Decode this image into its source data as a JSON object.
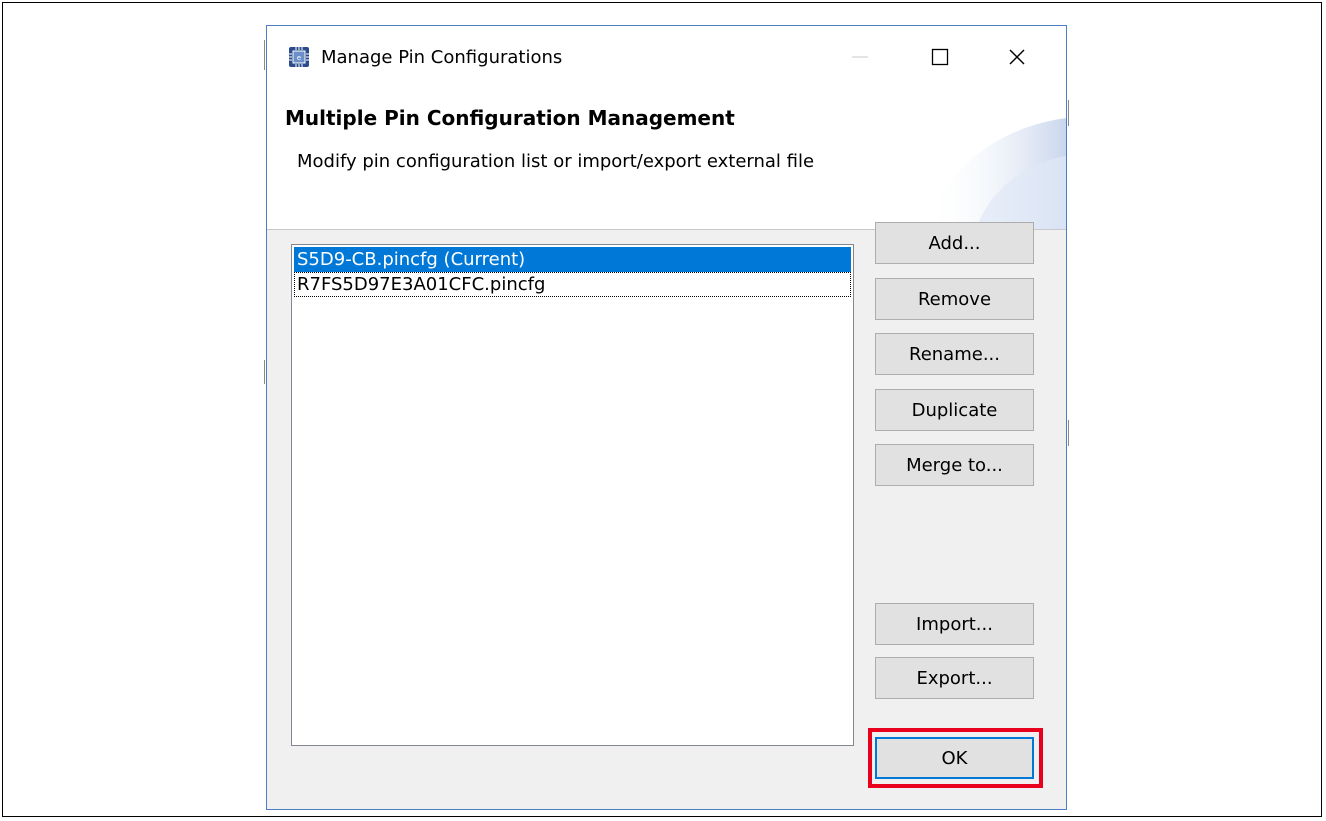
{
  "window": {
    "title": "Manage Pin Configurations",
    "icon": "chip-app-icon",
    "controls": {
      "minimize": "minimize-icon",
      "maximize": "maximize-icon",
      "close": "close-icon"
    }
  },
  "header": {
    "title": "Multiple Pin Configuration Management",
    "description": "Modify pin configuration list or import/export external file"
  },
  "config_list": {
    "items": [
      {
        "label": "S5D9-CB.pincfg (Current)",
        "selected": true
      },
      {
        "label": "R7FS5D97E3A01CFC.pincfg",
        "selected": false
      }
    ]
  },
  "buttons": {
    "add": "Add...",
    "remove": "Remove",
    "rename": "Rename...",
    "duplicate": "Duplicate",
    "merge": "Merge to...",
    "import": "Import...",
    "export": "Export...",
    "ok": "OK"
  },
  "colors": {
    "selection": "#0078d7",
    "highlight_box": "#e8001c",
    "dialog_border": "#4a7fc4"
  }
}
